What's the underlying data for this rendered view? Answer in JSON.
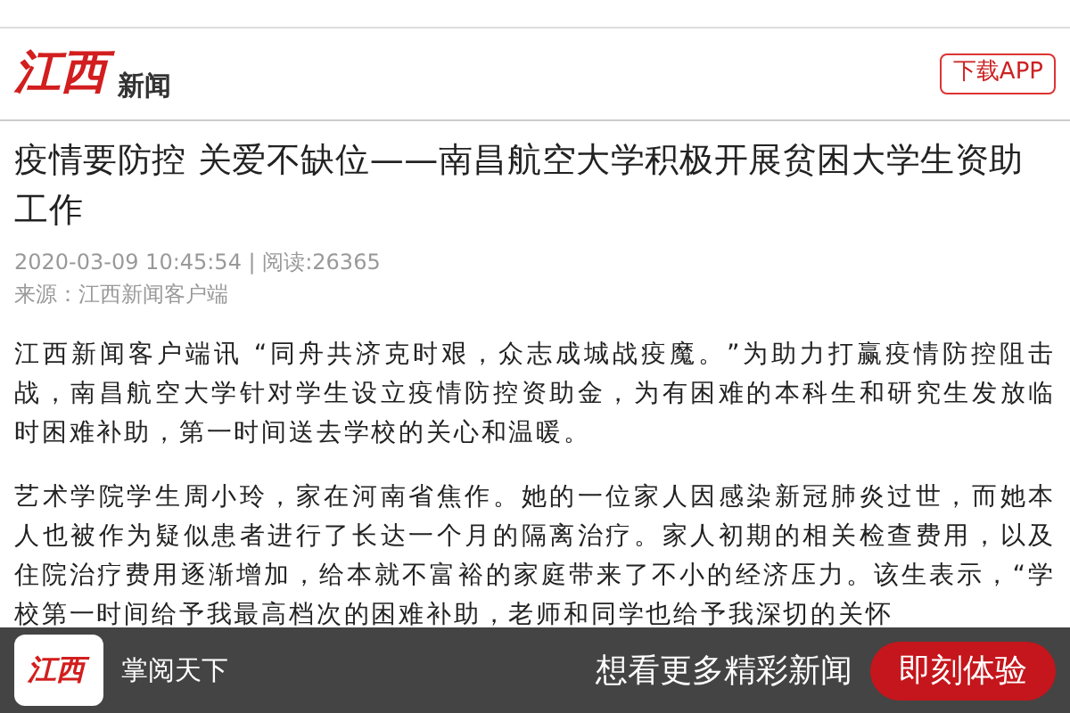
{
  "header": {
    "logo_mark": "江西",
    "logo_text": "新闻",
    "download_button": "下载APP"
  },
  "article": {
    "title": "疫情要防控  关爱不缺位——南昌航空大学积极开展贫困大学生资助工作",
    "meta": "2020-03-09 10:45:54 | 阅读:26365",
    "source": "来源：江西新闻客户端",
    "paragraphs": [
      "江西新闻客户端讯  “同舟共济克时艰，众志成城战疫魔。”为助力打赢疫情防控阻击战，南昌航空大学针对学生设立疫情防控资助金，为有困难的本科生和研究生发放临时困难补助，第一时间送去学校的关心和温暖。",
      "艺术学院学生周小玲，家在河南省焦作。她的一位家人因感染新冠肺炎过世，而她本人也被作为疑似患者进行了长达一个月的隔离治疗。家人初期的相关检查费用，以及住院治疗费用逐渐增加，给本就不富裕的家庭带来了不小的经济压力。该生表示，“学校第一时间给予我最高档次的困难补助，老师和同学也给予我深切的关怀"
    ]
  },
  "banner": {
    "logo_mark": "江西",
    "slogan": "掌阅天下",
    "promo": "想看更多精彩新闻",
    "button": "即刻体验"
  }
}
